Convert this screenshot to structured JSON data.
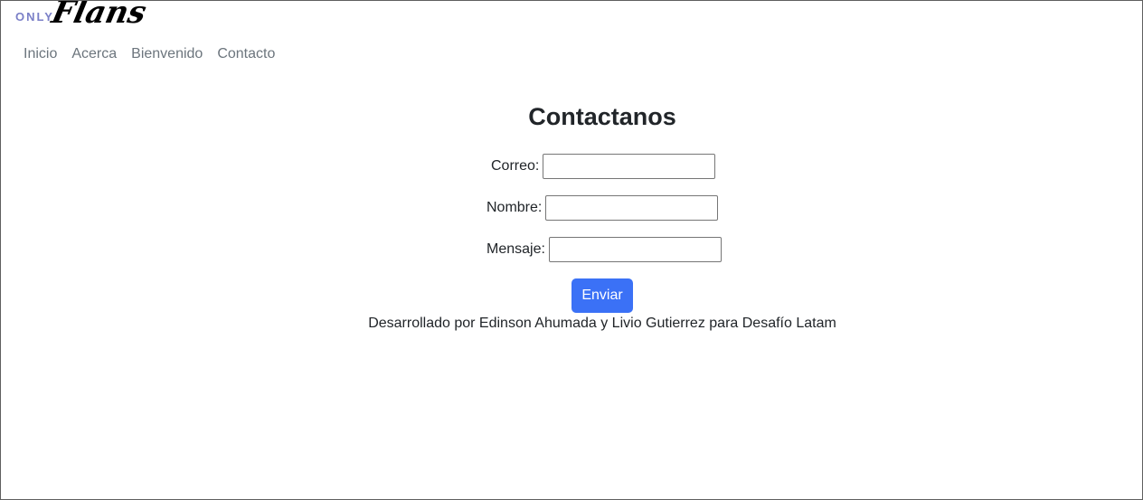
{
  "brand": {
    "only": "ONLY",
    "script": "Flans"
  },
  "nav": {
    "items": [
      "Inicio",
      "Acerca",
      "Bienvenido",
      "Contacto"
    ]
  },
  "page": {
    "title": "Contactanos"
  },
  "form": {
    "correo_label": "Correo:",
    "correo_value": "",
    "nombre_label": "Nombre:",
    "nombre_value": "",
    "mensaje_label": "Mensaje:",
    "mensaje_value": "",
    "submit_label": "Enviar"
  },
  "footer": {
    "credit": "Desarrollado por Edinson Ahumada y Livio Gutierrez para Desafío Latam"
  },
  "colors": {
    "accent": "#3b71f6",
    "nav_link": "#6c757d",
    "logo_only": "#7a7fc7"
  }
}
